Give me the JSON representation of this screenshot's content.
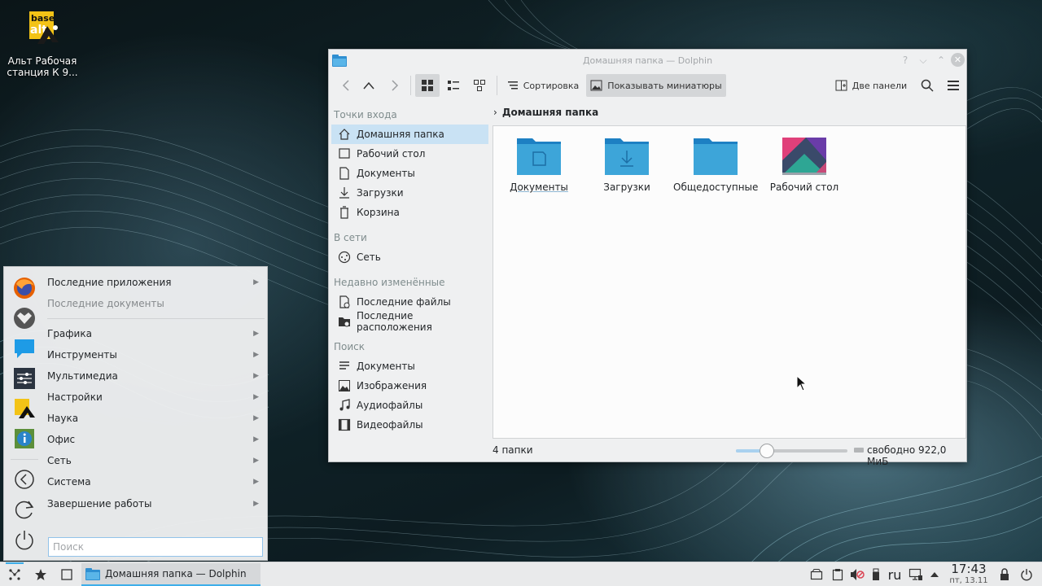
{
  "desktop": {
    "icon_label": "Альт Рабочая станция К 9...",
    "logo_text_top": "base",
    "logo_text_bottom": "alt"
  },
  "window": {
    "title": "Домашняя папка — Dolphin",
    "toolbar": {
      "sort_label": "Сортировка",
      "previews_label": "Показывать миниатюры",
      "split_label": "Две панели"
    },
    "places": {
      "entry_points_header": "Точки входа",
      "entry_points": [
        "Домашняя папка",
        "Рабочий стол",
        "Документы",
        "Загрузки",
        "Корзина"
      ],
      "network_header": "В сети",
      "network": [
        "Сеть"
      ],
      "recent_header": "Недавно изменённые",
      "recent": [
        "Последние файлы",
        "Последние расположения"
      ],
      "search_header": "Поиск",
      "search": [
        "Документы",
        "Изображения",
        "Аудиофайлы",
        "Видеофайлы"
      ]
    },
    "breadcrumb": "Домашняя папка",
    "files": [
      "Документы",
      "Загрузки",
      "Общедоступные",
      "Рабочий стол"
    ],
    "status": {
      "count": "4 папки",
      "free_space": "свободно 922,0 МиБ",
      "zoom_level": 0.28
    }
  },
  "menu": {
    "entries": [
      "Последние приложения",
      "Последние документы",
      "Графика",
      "Инструменты",
      "Мультимедиа",
      "Настройки",
      "Наука",
      "Офис",
      "Сеть",
      "Система",
      "Завершение работы"
    ],
    "search_placeholder": "Поиск"
  },
  "taskbar": {
    "task_label": "Домашняя папка — Dolphin",
    "keyboard_layout": "ru",
    "time": "17:43",
    "date": "пт, 13.11"
  },
  "colors": {
    "accent": "#3daee9",
    "folder": "#3da5d9",
    "selection": "#c9e2f4"
  }
}
